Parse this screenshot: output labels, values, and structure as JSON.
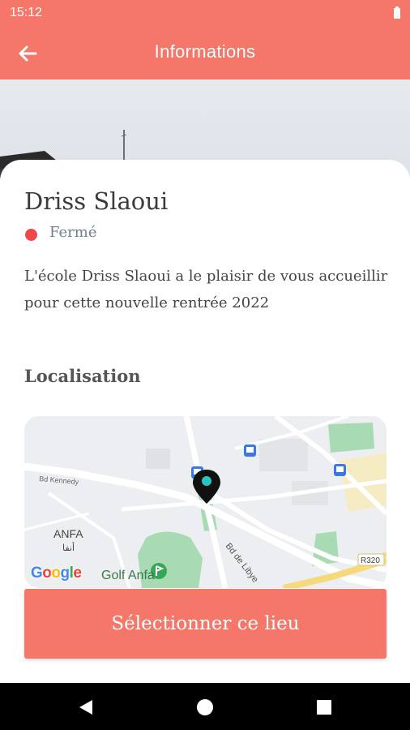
{
  "status_bar": {
    "time": "15:12",
    "battery_icon": "battery-icon"
  },
  "app_bar": {
    "title": "Informations",
    "back_icon": "arrow-left-icon"
  },
  "school": {
    "name": "Driss Slaoui",
    "status": "Fermé",
    "status_color": "#f0484a",
    "description": "L'école Driss Slaoui a le plaisir de vous accueillir pour cette nouvelle rentrée 2022"
  },
  "location": {
    "section_title": "Localisation",
    "map": {
      "district_label": "ANFA",
      "district_label_ar": "أنفا",
      "street_kennedy": "Bd Kennedy",
      "street_libye": "Bd de Libye",
      "road_code": "R320",
      "poi_golf": "Golf Anfa",
      "google_logo": "Google",
      "marker_icon": "map-pin-icon"
    }
  },
  "actions": {
    "select_label": "Sélectionner ce lieu"
  },
  "colors": {
    "accent": "#f47769",
    "map_green": "#a8dbb3",
    "marker_teal": "#2bc4c4"
  }
}
